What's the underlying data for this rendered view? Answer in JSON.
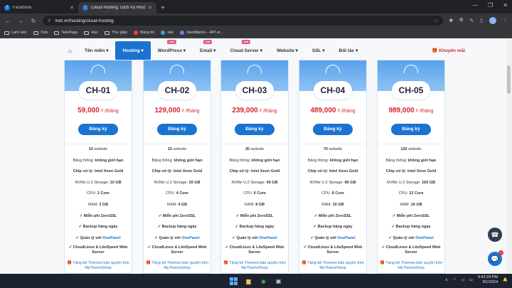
{
  "browser": {
    "tabs": [
      {
        "title": "Facebook",
        "icon": "facebook-icon",
        "active": false
      },
      {
        "title": "Cloud Hosting: Dịch Vụ Hosting",
        "icon": "inet-icon",
        "active": true
      }
    ],
    "url": "inet.vn/hosting/cloud-hosting",
    "bookmarks": [
      "Làm việc",
      "Tom",
      "TelePage",
      "Học",
      "Thư giãn",
      "Bảng tin",
      "oke",
      "Identifiants – API et..."
    ]
  },
  "nav": {
    "items": [
      {
        "label": "Tên miền",
        "caret": true,
        "hot": ""
      },
      {
        "label": "Hosting",
        "caret": true,
        "hot": "",
        "active": true
      },
      {
        "label": "WordPress",
        "caret": true,
        "hot": "hot"
      },
      {
        "label": "Email",
        "caret": true,
        "hot": "hot"
      },
      {
        "label": "Cloud Server",
        "caret": true,
        "hot": "hot"
      },
      {
        "label": "Website",
        "caret": true,
        "hot": ""
      },
      {
        "label": "SSL",
        "caret": true,
        "hot": ""
      },
      {
        "label": "Đối tác",
        "caret": true,
        "hot": ""
      }
    ],
    "promo": "Khuyến mãi"
  },
  "common": {
    "register": "Đăng ký",
    "unit": " ₫ /tháng",
    "bandwidth_label": "Băng thông:",
    "bandwidth_value": "không giới hạn",
    "cpu_label": "Chip xử lý:",
    "cpu_value": "Intel Xeon Gold",
    "nvme_label": "NVMe U.2 Storage:",
    "ssl": "✓ Miễn phí ZeroSSL",
    "backup": "✓ Backup hàng ngày",
    "panel_prefix": "✓ Quản lý với",
    "panel_name": "OnePanel",
    "webserver": "✓ CloudLinux & LiteSpeed Web Server",
    "gift": "Tặng bộ Themes bản quyền trên MyThemeShop"
  },
  "plans": [
    {
      "name": "CH-01",
      "price": "59,000",
      "websites": "10",
      "storage": "10 GB",
      "cpu": "2 Core",
      "ram": "2 GB"
    },
    {
      "name": "CH-02",
      "price": "129,000",
      "websites": "15",
      "storage": "20 GB",
      "cpu": "4 Core",
      "ram": "4 GB"
    },
    {
      "name": "CH-03",
      "price": "239,000",
      "websites": "30",
      "storage": "40 GB",
      "cpu": "6 Core",
      "ram": "8 GB"
    },
    {
      "name": "CH-04",
      "price": "489,000",
      "websites": "70",
      "storage": "80 GB",
      "cpu": "8 Core",
      "ram": "10 GB"
    },
    {
      "name": "CH-05",
      "price": "989,000",
      "websites": "120",
      "storage": "160 GB",
      "cpu": "12 Core",
      "ram": "16 GB"
    }
  ],
  "taskbar": {
    "time": "9:42:24 PM",
    "date": "8/1/2024",
    "chat_badge": "8"
  }
}
